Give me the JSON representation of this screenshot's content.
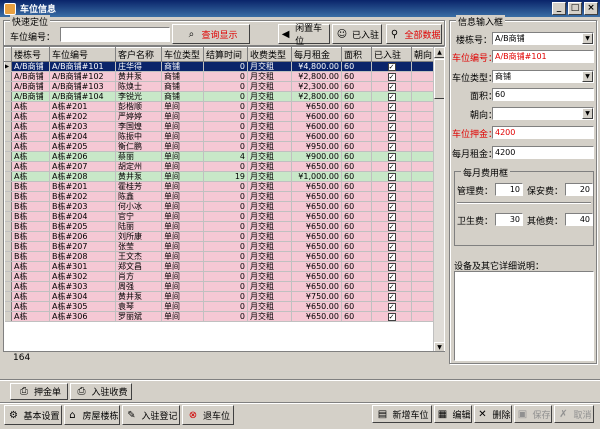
{
  "window": {
    "title": "车位信息"
  },
  "quick": {
    "group_label": "快速定位",
    "space_label": "车位编号：",
    "search_value": "",
    "query_btn": "查询显示",
    "idle_btn": "闲置车位",
    "occupied_btn": "已入驻",
    "all_btn": "全部数据"
  },
  "grid": {
    "headers": [
      "楼栋号",
      "车位编号",
      "客户名称",
      "车位类型",
      "结算时间",
      "收费类型",
      "每月租金",
      "面积",
      "已入驻",
      "朝向"
    ],
    "rows": [
      [
        "A/B商铺",
        "A/B商铺#101",
        "庄华得",
        "商铺",
        "0",
        "月交租",
        "¥4,800.00",
        "60"
      ],
      [
        "A/B商铺",
        "A/B商铺#102",
        "黄井泵",
        "商铺",
        "0",
        "月交租",
        "¥2,800.00",
        "60"
      ],
      [
        "A/B商铺",
        "A/B商铺#103",
        "陈焕士",
        "商铺",
        "0",
        "月交租",
        "¥2,300.00",
        "60"
      ],
      [
        "A/B商铺",
        "A/B商铺#104",
        "李锐光",
        "商铺",
        "0",
        "月交租",
        "¥2,800.00",
        "60"
      ],
      [
        "A栋",
        "A栋#201",
        "彭楷顺",
        "单间",
        "0",
        "月交租",
        "¥650.00",
        "60"
      ],
      [
        "A栋",
        "A栋#202",
        "严婷婷",
        "单间",
        "0",
        "月交租",
        "¥600.00",
        "60"
      ],
      [
        "A栋",
        "A栋#203",
        "李国煌",
        "单间",
        "0",
        "月交租",
        "¥600.00",
        "60"
      ],
      [
        "A栋",
        "A栋#204",
        "陈振中",
        "单间",
        "0",
        "月交租",
        "¥600.00",
        "60"
      ],
      [
        "A栋",
        "A栋#205",
        "衡仁鹏",
        "单间",
        "0",
        "月交租",
        "¥950.00",
        "60"
      ],
      [
        "A栋",
        "A栋#206",
        "蔡丽",
        "单间",
        "4",
        "月交租",
        "¥900.00",
        "60"
      ],
      [
        "A栋",
        "A栋#207",
        "胡定州",
        "单间",
        "0",
        "月交租",
        "¥650.00",
        "60"
      ],
      [
        "A栋",
        "A栋#208",
        "黄井泵",
        "单间",
        "19",
        "月交租",
        "¥1,000.00",
        "60"
      ],
      [
        "B栋",
        "B栋#201",
        "霍桂芳",
        "单间",
        "0",
        "月交租",
        "¥650.00",
        "60"
      ],
      [
        "B栋",
        "B栋#202",
        "陈鑫",
        "单间",
        "0",
        "月交租",
        "¥650.00",
        "60"
      ],
      [
        "B栋",
        "B栋#203",
        "何小冰",
        "单间",
        "0",
        "月交租",
        "¥650.00",
        "60"
      ],
      [
        "B栋",
        "B栋#204",
        "官宁",
        "单间",
        "0",
        "月交租",
        "¥650.00",
        "60"
      ],
      [
        "B栋",
        "B栋#205",
        "陆丽",
        "单间",
        "0",
        "月交租",
        "¥650.00",
        "60"
      ],
      [
        "B栋",
        "B栋#206",
        "刘所康",
        "单间",
        "0",
        "月交租",
        "¥650.00",
        "60"
      ],
      [
        "B栋",
        "B栋#207",
        "张莹",
        "单间",
        "0",
        "月交租",
        "¥650.00",
        "60"
      ],
      [
        "B栋",
        "B栋#208",
        "王文杰",
        "单间",
        "0",
        "月交租",
        "¥650.00",
        "60"
      ],
      [
        "A栋",
        "A栋#301",
        "郑文昌",
        "单间",
        "0",
        "月交租",
        "¥650.00",
        "60"
      ],
      [
        "A栋",
        "A栋#302",
        "肖方",
        "单间",
        "0",
        "月交租",
        "¥650.00",
        "60"
      ],
      [
        "A栋",
        "A栋#303",
        "周强",
        "单间",
        "0",
        "月交租",
        "¥650.00",
        "60"
      ],
      [
        "A栋",
        "A栋#304",
        "黄井泵",
        "单间",
        "0",
        "月交租",
        "¥750.00",
        "60"
      ],
      [
        "A栋",
        "A栋#305",
        "袁琴",
        "单间",
        "0",
        "月交租",
        "¥650.00",
        "60"
      ],
      [
        "A栋",
        "A栋#306",
        "罗丽斌",
        "单间",
        "0",
        "月交租",
        "¥650.00",
        "60"
      ]
    ],
    "row_count": "164"
  },
  "info": {
    "group_label": "信息输入框",
    "building_label": "楼栋号：",
    "building_value": "A/B商铺",
    "space_no_label": "车位编号：",
    "space_no_value": "A/B商铺#101",
    "space_type_label": "车位类型：",
    "space_type_value": "商铺",
    "area_label": "面积：",
    "area_value": "60",
    "orient_label": "朝向：",
    "orient_value": "",
    "deposit_label": "车位押金：",
    "deposit_value": "4200",
    "rent_label": "每月租金：",
    "rent_value": "4200",
    "fee_group_label": "每月费用框",
    "mgmt_label": "管理费：",
    "mgmt_value": "10",
    "security_label": "保安费：",
    "security_value": "20",
    "sanitation_label": "卫生费：",
    "sanitation_value": "30",
    "other_label": "其他费：",
    "other_value": "40",
    "notes_label": "设备及其它详细说明："
  },
  "toolbar": {
    "deposit_btn": "押金单",
    "checkin_fee_btn": "入驻收费",
    "basic_btn": "基本设置",
    "building_btn": "房屋楼栋",
    "register_btn": "入驻登记",
    "return_btn": "退车位",
    "new_btn": "新增车位",
    "edit_btn": "编辑",
    "delete_btn": "删除",
    "save_btn": "保存",
    "cancel_btn": "取消"
  }
}
